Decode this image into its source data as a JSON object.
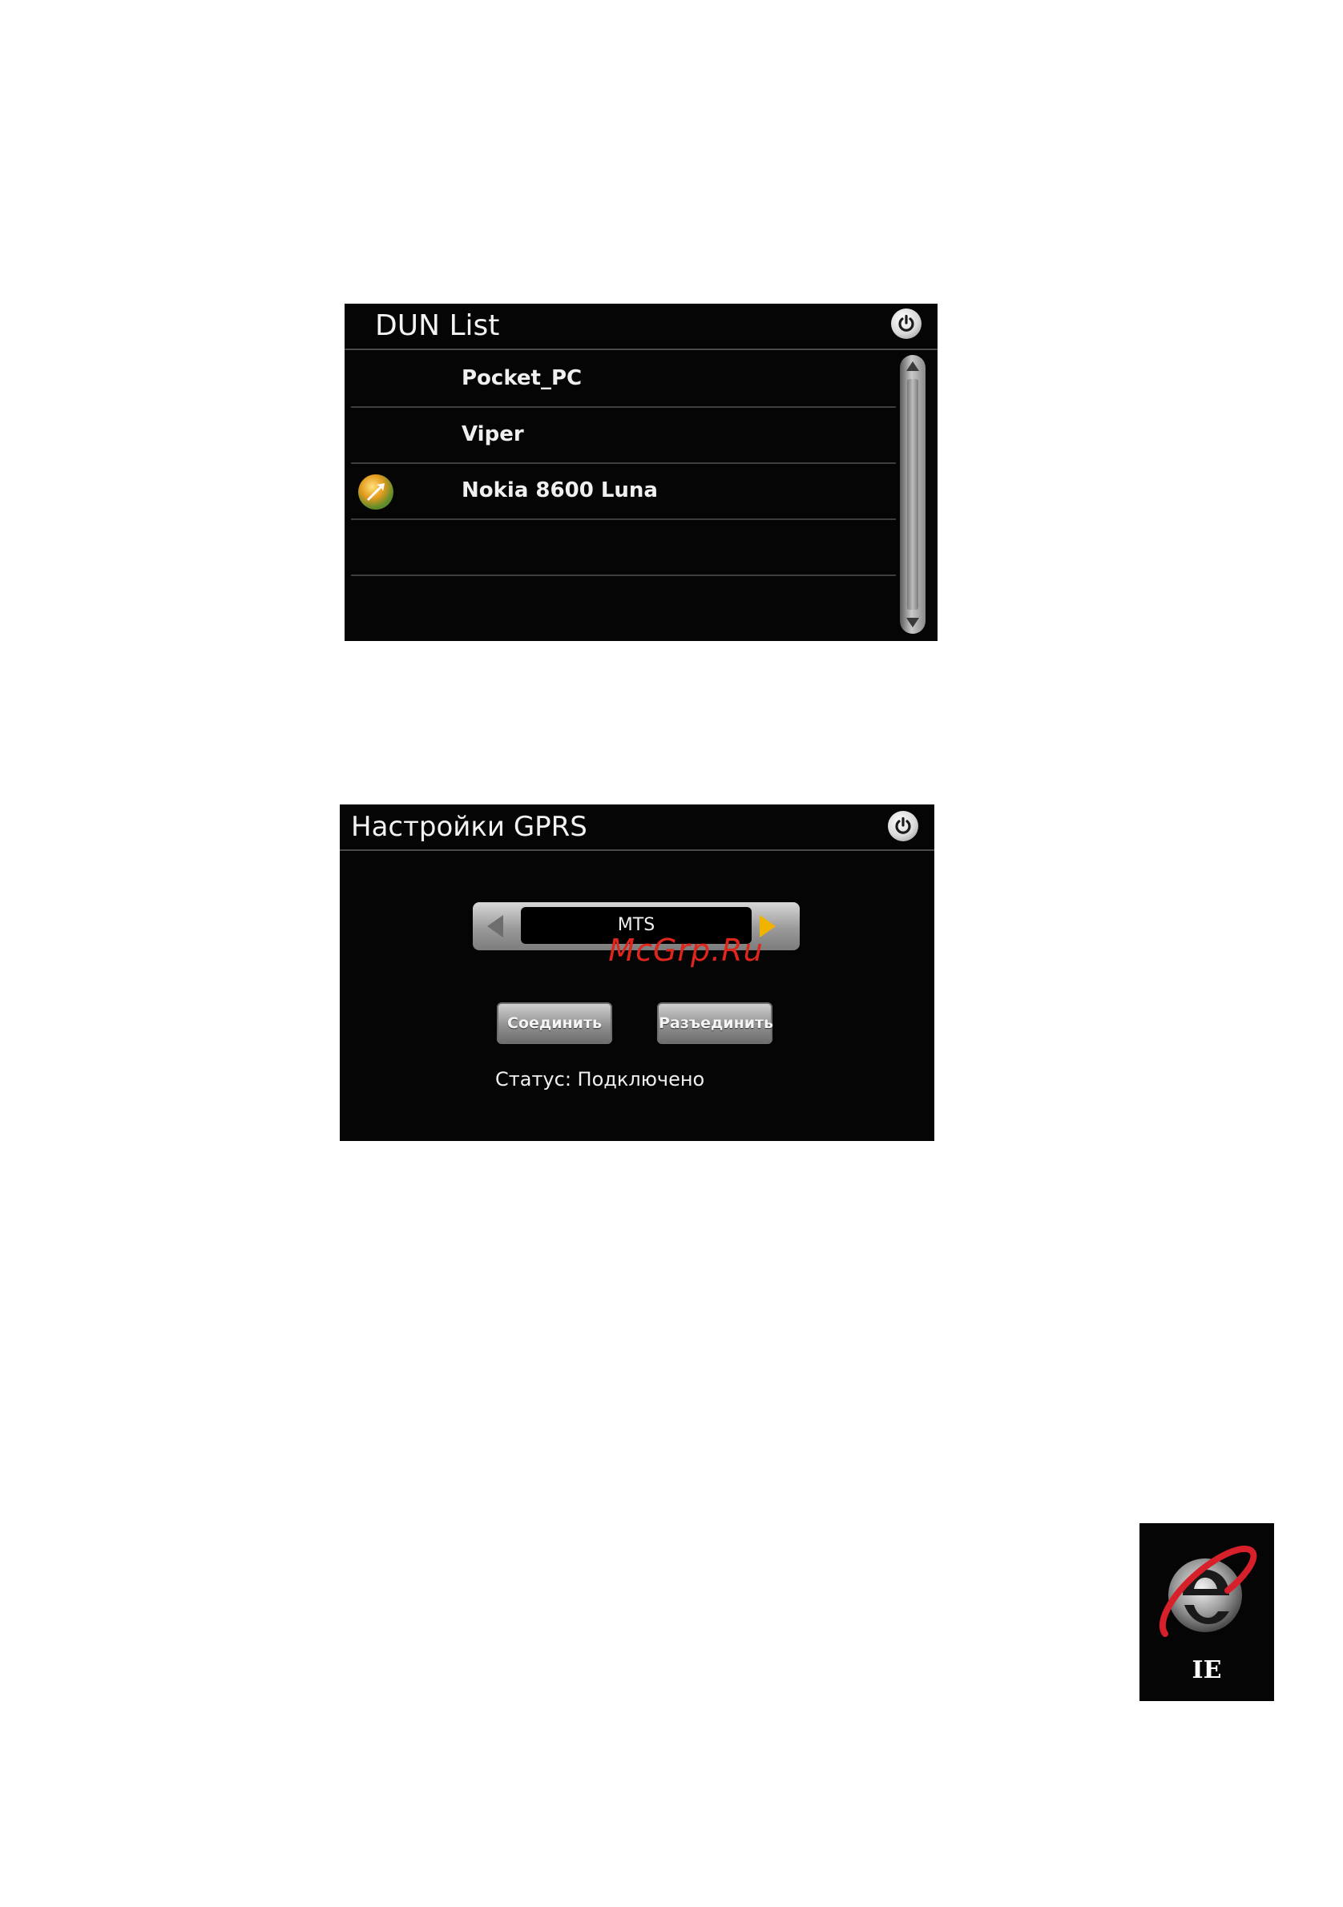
{
  "dun_list": {
    "title": "DUN List",
    "items": [
      {
        "label": "Pocket_PC",
        "connected": false
      },
      {
        "label": "Viper",
        "connected": false
      },
      {
        "label": "Nokia 8600 Luna",
        "connected": true
      },
      {
        "label": "",
        "connected": false
      }
    ],
    "power_icon": "power-icon"
  },
  "gprs": {
    "title": "Настройки GPRS",
    "operator": "MTS",
    "watermark": "McGrp.Ru",
    "connect_label": "Соединить",
    "disconnect_label": "Разъединить",
    "status": "Статус: Подключено",
    "power_icon": "power-icon",
    "accent_color": "#f0b400"
  },
  "ie_icon": {
    "label": "IE",
    "icon": "internet-explorer-icon"
  }
}
